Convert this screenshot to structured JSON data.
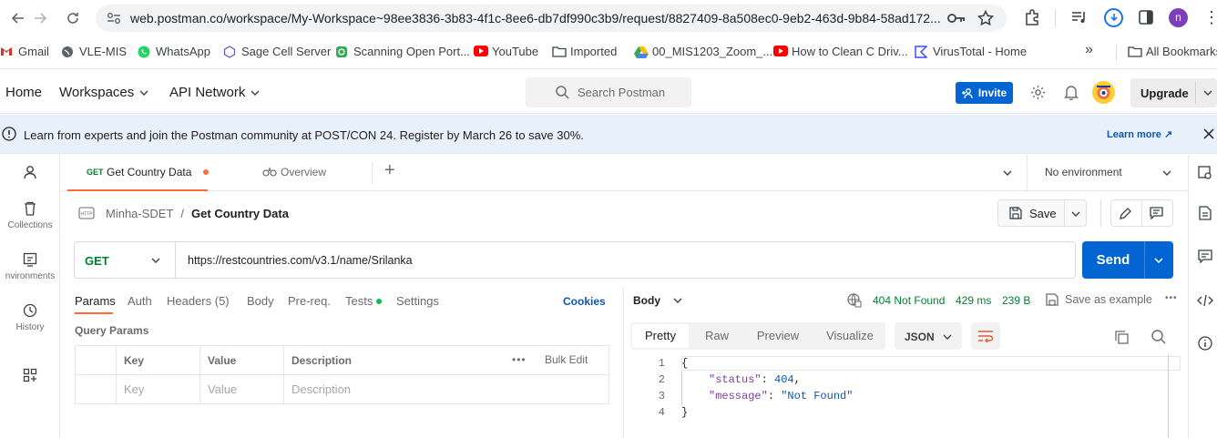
{
  "browser": {
    "url": "web.postman.co/workspace/My-Workspace~98ee3836-3b83-4f1c-8ee6-db7df990c3b9/request/8827409-8a508ec0-9eb2-463d-9b84-58ad172...",
    "profile_initial": "n",
    "bookmarks": [
      "Gmail",
      "VLE-MIS",
      "WhatsApp",
      "Sage Cell Server",
      "Scanning Open Port...",
      "YouTube",
      "Imported",
      "00_MIS1203_Zoom_...",
      "How to Clean C Driv...",
      "VirusTotal - Home"
    ],
    "more_bookmarks": "»",
    "all_bookmarks": "All Bookmarks"
  },
  "header": {
    "home": "Home",
    "workspaces": "Workspaces",
    "api_network": "API Network",
    "search_placeholder": "Search Postman",
    "invite": "Invite",
    "upgrade": "Upgrade"
  },
  "banner": {
    "text": "Learn from experts and join the Postman community at POST/CON 24. Register by March 26 to save 30%.",
    "link": "Learn more ↗"
  },
  "sidebar": {
    "collections": "Collections",
    "environments": "nvironments",
    "history": "History"
  },
  "tabs": {
    "active_method": "GET",
    "active_title": "Get Country Data",
    "overview": "Overview",
    "add": "+",
    "environment": "No environment"
  },
  "request": {
    "breadcrumb_collection": "Minha-SDET",
    "breadcrumb_sep": "/",
    "name": "Get Country Data",
    "save": "Save",
    "method": "GET",
    "url": "https://restcountries.com/v3.1/name/Srilanka",
    "send": "Send",
    "tabs": [
      "Params",
      "Auth",
      "Headers (5)",
      "Body",
      "Pre-req.",
      "Tests",
      "Settings"
    ],
    "cookies": "Cookies",
    "query_params_title": "Query Params",
    "columns": [
      "Key",
      "Value",
      "Description"
    ],
    "bulk_edit": "Bulk Edit",
    "placeholders": [
      "Key",
      "Value",
      "Description"
    ]
  },
  "response": {
    "body_label": "Body",
    "status": "404 Not Found",
    "time": "429 ms",
    "size": "239 B",
    "save_example": "Save as example",
    "format_tabs": [
      "Pretty",
      "Raw",
      "Preview",
      "Visualize"
    ],
    "format": "JSON",
    "line_numbers": [
      "1",
      "2",
      "3",
      "4"
    ],
    "lines": [
      "{",
      "\"status\": 404,",
      "\"message\": \"Not Found\"",
      "}"
    ]
  },
  "colors": {
    "primary_blue": "#0265d2",
    "postman_orange": "#ff6c37",
    "banner_bg": "#e7f0fb",
    "status_green": "#007f31"
  }
}
